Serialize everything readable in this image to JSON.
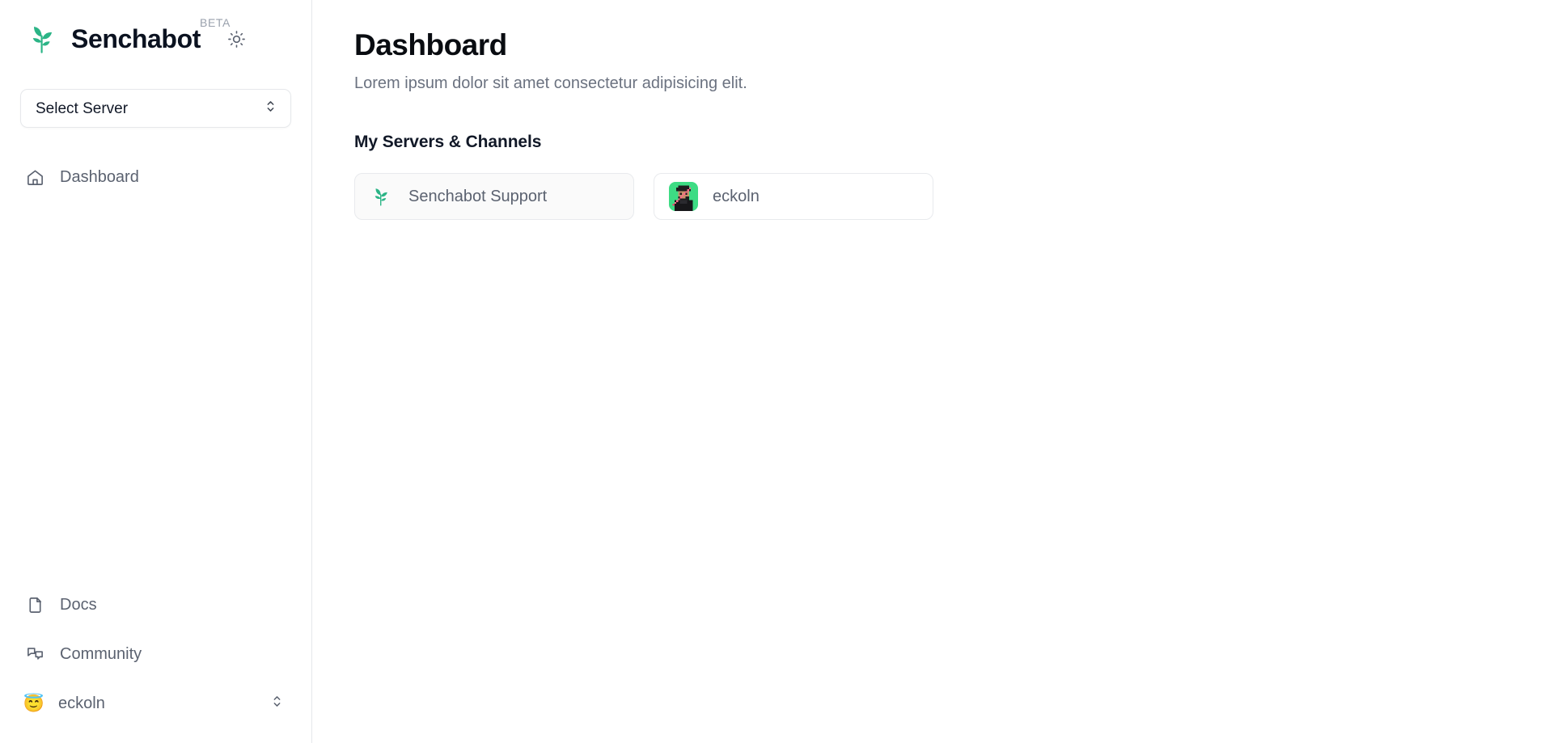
{
  "brand": {
    "name": "Senchabot",
    "badge": "BETA",
    "logo_icon": "sprout-icon",
    "theme_toggle_icon": "sun-icon",
    "accent_color": "#2bb486"
  },
  "sidebar": {
    "server_select": {
      "label": "Select Server",
      "icon": "chevron-up-down-icon"
    },
    "nav_top": [
      {
        "label": "Dashboard",
        "icon": "home-icon"
      }
    ],
    "nav_bottom": [
      {
        "label": "Docs",
        "icon": "file-icon"
      },
      {
        "label": "Community",
        "icon": "chat-bubbles-icon"
      }
    ],
    "user": {
      "name": "eckoln",
      "emoji": "😇",
      "icon": "chevron-up-down-icon"
    }
  },
  "main": {
    "title": "Dashboard",
    "subtitle": "Lorem ipsum dolor sit amet consectetur adipisicing elit.",
    "section_title": "My Servers & Channels",
    "cards": [
      {
        "label": "Senchabot Support",
        "avatar": "sprout-icon"
      },
      {
        "label": "eckoln",
        "avatar": "pixel-portrait-avatar"
      }
    ]
  },
  "colors": {
    "accent_green": "#2bb486",
    "avatar_green": "#3ddc84",
    "text_muted": "#5b6270",
    "border": "#e5e7eb"
  }
}
